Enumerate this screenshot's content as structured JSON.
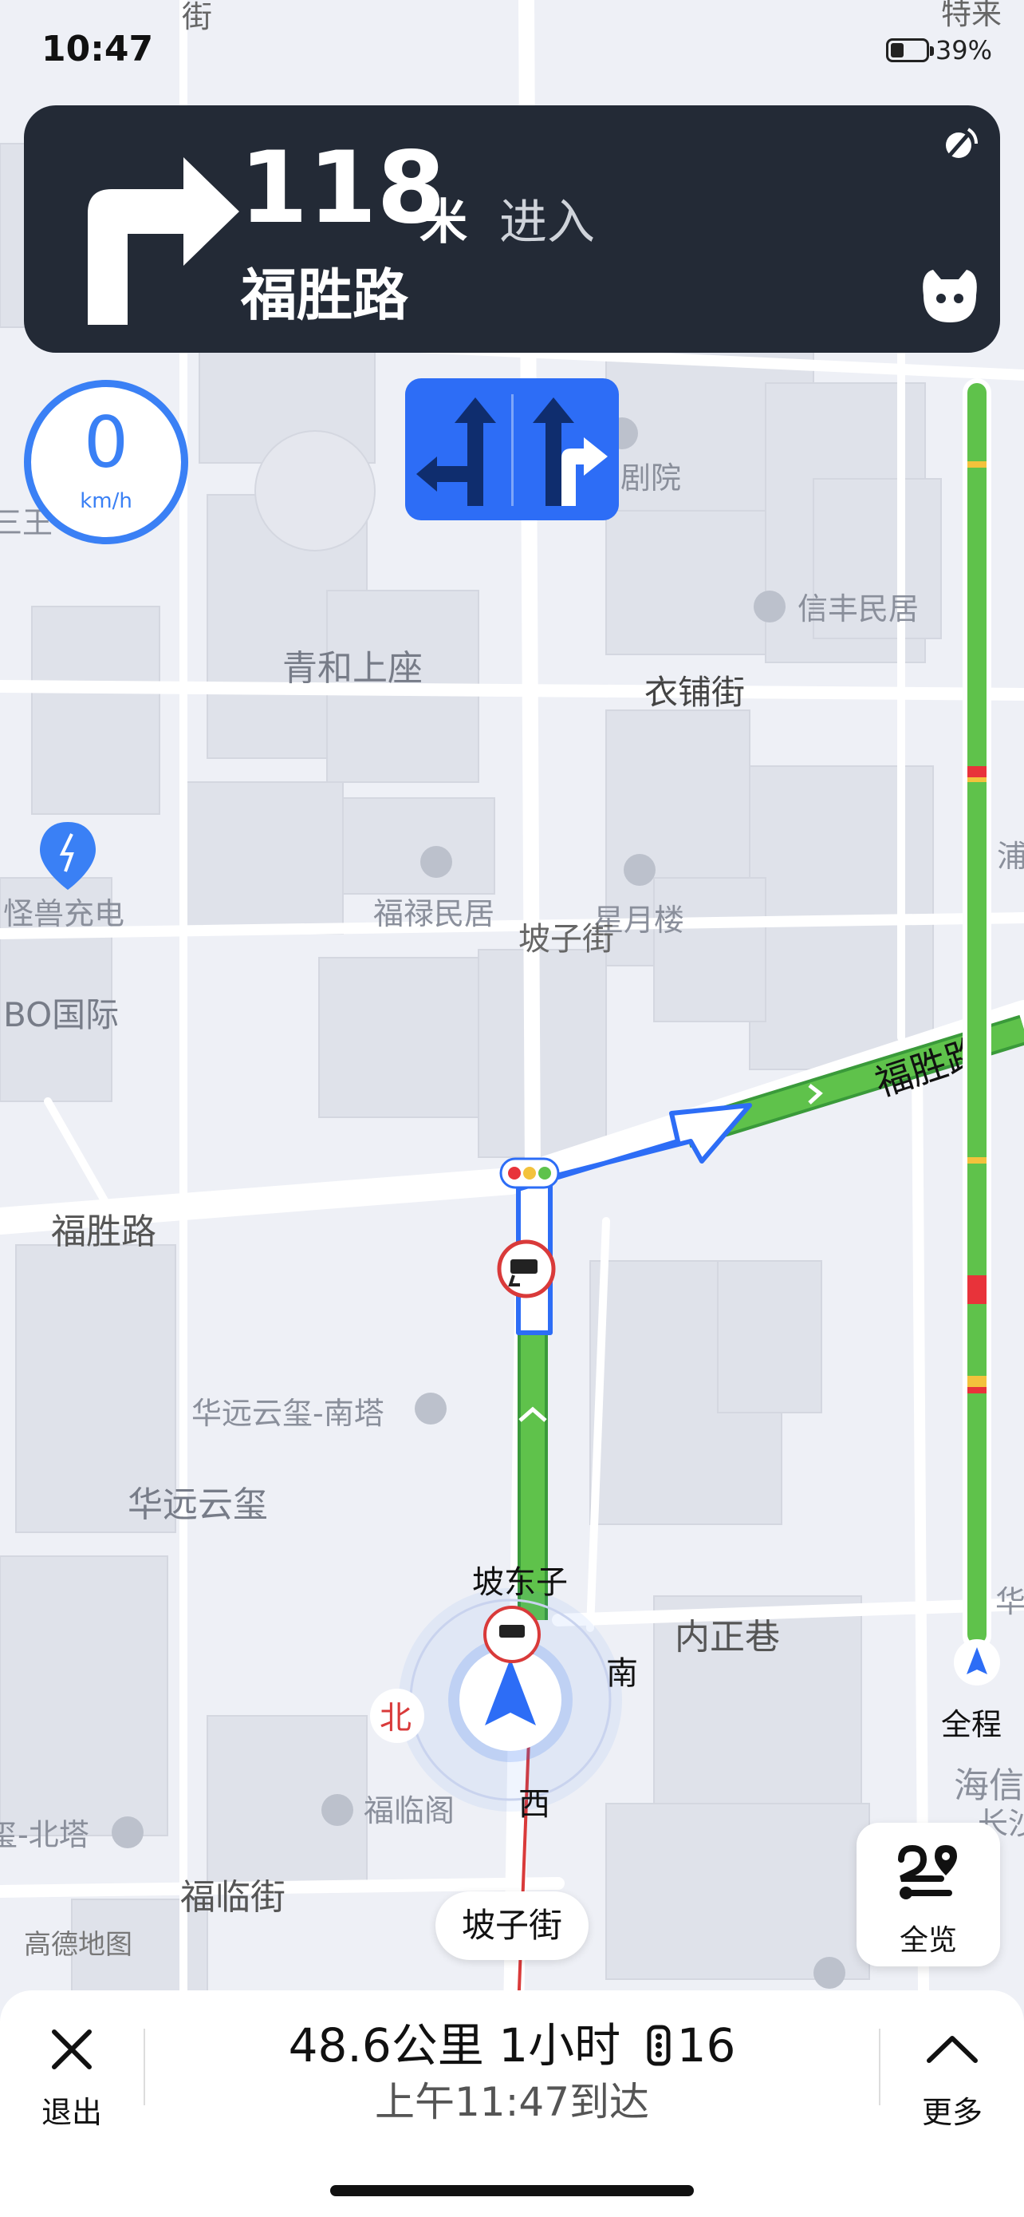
{
  "status_bar": {
    "time": "10:47",
    "battery": "39%",
    "battery_level": 0.39
  },
  "navigation": {
    "distance": "118",
    "unit": "米",
    "action": "进入",
    "road": "福胜路",
    "next_turn": "right"
  },
  "speed": {
    "value": "0",
    "unit": "km/h"
  },
  "lanes": [
    {
      "directions": [
        "left",
        "straight"
      ],
      "recommended": true
    },
    {
      "directions": [
        "straight",
        "right"
      ],
      "recommended": true
    }
  ],
  "map_labels": {
    "tl_street": "街",
    "tr_fragment": "特来",
    "theater": "剧院",
    "third_king": "三王",
    "xinfeng": "信丰民居",
    "qinghe": "青和上座",
    "yipu": "衣铺街",
    "charger": "怪兽充电",
    "fulu": "福禄民居",
    "xingyue": "星月楼",
    "pozi_vertical": "坡子街",
    "bo_intl": "BO国际",
    "pu_fragment": "浦",
    "fusheng_left": "福胜路",
    "fusheng_right": "福胜路",
    "huayuan_south": "华远云玺-南塔",
    "huayuan": "华远云玺",
    "pozi_dong": "坡东子",
    "neizheng": "内正巷",
    "hua_fragment": "华",
    "nan": "南",
    "bei": "北",
    "xi": "西",
    "fulin_pavilion": "福临阁",
    "north_tower": "玺-北塔",
    "haixin": "海信",
    "changsha": "长沙",
    "fulin_street": "福临街",
    "gaode": "高德地图"
  },
  "route_overview_label": "全程",
  "overview_button": "全览",
  "current_street": "坡子街",
  "bottom": {
    "exit_label": "退出",
    "more_label": "更多",
    "trip_distance": "48.6公里",
    "trip_time": "1小时",
    "traffic_lights": "16",
    "arrival": "上午11:47到达"
  },
  "colors": {
    "route_green": "#5fc24b",
    "congestion_red": "#e8333a",
    "slow_yellow": "#f3c23c",
    "accent_blue": "#2d6df6",
    "banner_dark": "#232a36"
  }
}
